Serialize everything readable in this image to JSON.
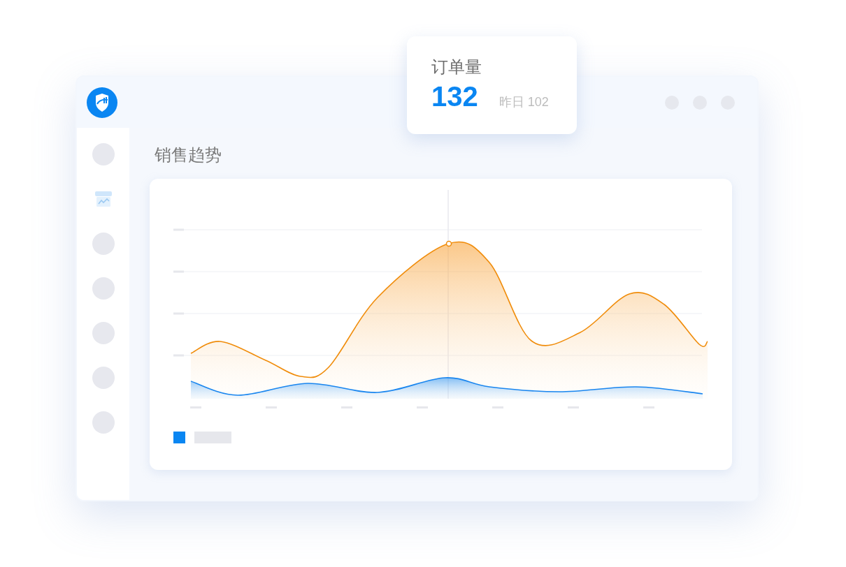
{
  "sidebar": {
    "items": [
      {
        "selected": false
      },
      {
        "selected": true
      },
      {
        "selected": false
      },
      {
        "selected": false
      },
      {
        "selected": false
      },
      {
        "selected": false
      },
      {
        "selected": false
      }
    ]
  },
  "section_title": "销售趋势",
  "popup": {
    "title": "订单量",
    "value": "132",
    "comparison": "昨日 102"
  }
}
